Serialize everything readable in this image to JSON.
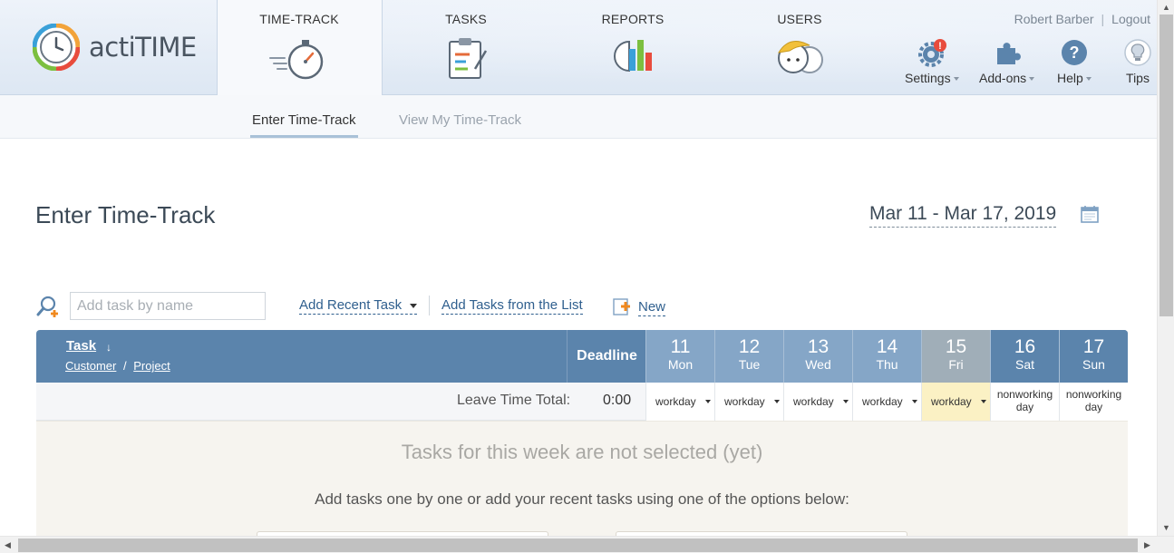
{
  "app": {
    "name": "actiTIME"
  },
  "nav": {
    "tabs": [
      {
        "label": "TIME-TRACK",
        "active": true
      },
      {
        "label": "TASKS"
      },
      {
        "label": "REPORTS"
      },
      {
        "label": "USERS"
      }
    ]
  },
  "user": {
    "name": "Robert Barber",
    "separator": "|",
    "logout": "Logout"
  },
  "tools": [
    {
      "label": "Settings",
      "icon": "gear-icon",
      "alert": "!"
    },
    {
      "label": "Add-ons",
      "icon": "puzzle-icon"
    },
    {
      "label": "Help",
      "icon": "help-icon",
      "glyph": "?"
    },
    {
      "label": "Tips",
      "icon": "lightbulb-icon"
    }
  ],
  "subnav": {
    "items": [
      "Enter Time-Track",
      "View My Time-Track"
    ],
    "active_index": 0
  },
  "page": {
    "title": "Enter Time-Track",
    "date_range": "Mar 11 - Mar 17, 2019"
  },
  "toolbar": {
    "search_placeholder": "Add task by name",
    "add_recent": "Add Recent Task",
    "add_from_list": "Add Tasks from the List",
    "new": "New"
  },
  "grid": {
    "task_header": "Task",
    "sort_arrow": "↓",
    "customer": "Customer",
    "cp_sep": "/",
    "project": "Project",
    "deadline": "Deadline",
    "days": [
      {
        "num": "11",
        "dow": "Mon",
        "status": "workday"
      },
      {
        "num": "12",
        "dow": "Tue",
        "status": "workday"
      },
      {
        "num": "13",
        "dow": "Wed",
        "status": "workday"
      },
      {
        "num": "14",
        "dow": "Thu",
        "status": "workday"
      },
      {
        "num": "15",
        "dow": "Fri",
        "status": "workday",
        "today": true
      },
      {
        "num": "16",
        "dow": "Sat",
        "status_line1": "nonworking",
        "status_line2": "day"
      },
      {
        "num": "17",
        "dow": "Sun",
        "status_line1": "nonworking",
        "status_line2": "day"
      }
    ],
    "leave_label": "Leave Time Total:",
    "leave_value": "0:00",
    "empty_title": "Tasks for this week are not selected (yet)",
    "empty_sub": "Add tasks one by one or add your recent tasks using one of the options below:"
  },
  "colors": {
    "header_blue": "#5b84ac",
    "link": "#2f5f8e",
    "today": "#fbf1c4",
    "empty_bg": "#f6f4ef"
  }
}
